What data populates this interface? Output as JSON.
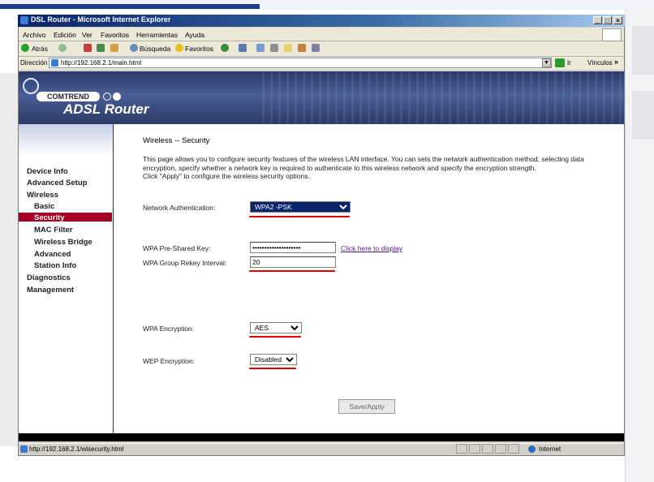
{
  "window": {
    "title": "DSL Router - Microsoft Internet Explorer",
    "min_label": "_",
    "max_label": "□",
    "close_label": "×"
  },
  "menu": [
    "Archivo",
    "Edición",
    "Ver",
    "Favoritos",
    "Herramientas",
    "Ayuda"
  ],
  "toolbar": {
    "back_label": "Atrás",
    "search_label": "Búsqueda",
    "favorites_label": "Favoritos"
  },
  "address": {
    "label": "Dirección",
    "url": "http://192.168.2.1/main.html",
    "go_label": "Ir",
    "links_label": "Vínculos"
  },
  "banner": {
    "brand": "COMTREND",
    "product": "ADSL Router"
  },
  "nav": {
    "items": [
      {
        "label": "Device Info",
        "level": 0
      },
      {
        "label": "Advanced Setup",
        "level": 0
      },
      {
        "label": "Wireless",
        "level": 0
      },
      {
        "label": "Basic",
        "level": 1
      },
      {
        "label": "Security",
        "level": 1,
        "selected": true
      },
      {
        "label": "MAC Filter",
        "level": 1
      },
      {
        "label": "Wireless Bridge",
        "level": 1
      },
      {
        "label": "Advanced",
        "level": 1
      },
      {
        "label": "Station Info",
        "level": 1
      },
      {
        "label": "Diagnostics",
        "level": 0
      },
      {
        "label": "Management",
        "level": 0
      }
    ]
  },
  "page": {
    "title": "Wireless -- Security",
    "description": "This page allows you to configure security features of the wireless LAN interface. You can sets the network authentication method, selecting data encryption, specify whether a network key is required to authenticate to this wireless network and specify the encryption strength.",
    "instruction": "Click \"Apply\" to configure the wireless security options."
  },
  "form": {
    "network_auth": {
      "label": "Network Authentication:",
      "value": "WPA2 -PSK"
    },
    "psk": {
      "label": "WPA Pre-Shared Key:",
      "value": "••••••••••••••••••••",
      "link": "Click here to display"
    },
    "rekey": {
      "label": "WPA Group Rekey Interval:",
      "value": "20"
    },
    "wpa_encryption": {
      "label": "WPA Encryption:",
      "value": "AES"
    },
    "wep_encryption": {
      "label": "WEP Encryption:",
      "value": "Disabled"
    },
    "apply_label": "Save/Apply"
  },
  "status": {
    "url": "http://192.168.2.1/wlsecurity.html",
    "zone": "Internet"
  },
  "colors": {
    "accent": "#a50021",
    "annotation_red": "#e00000",
    "title_blue": "#0a246a"
  }
}
